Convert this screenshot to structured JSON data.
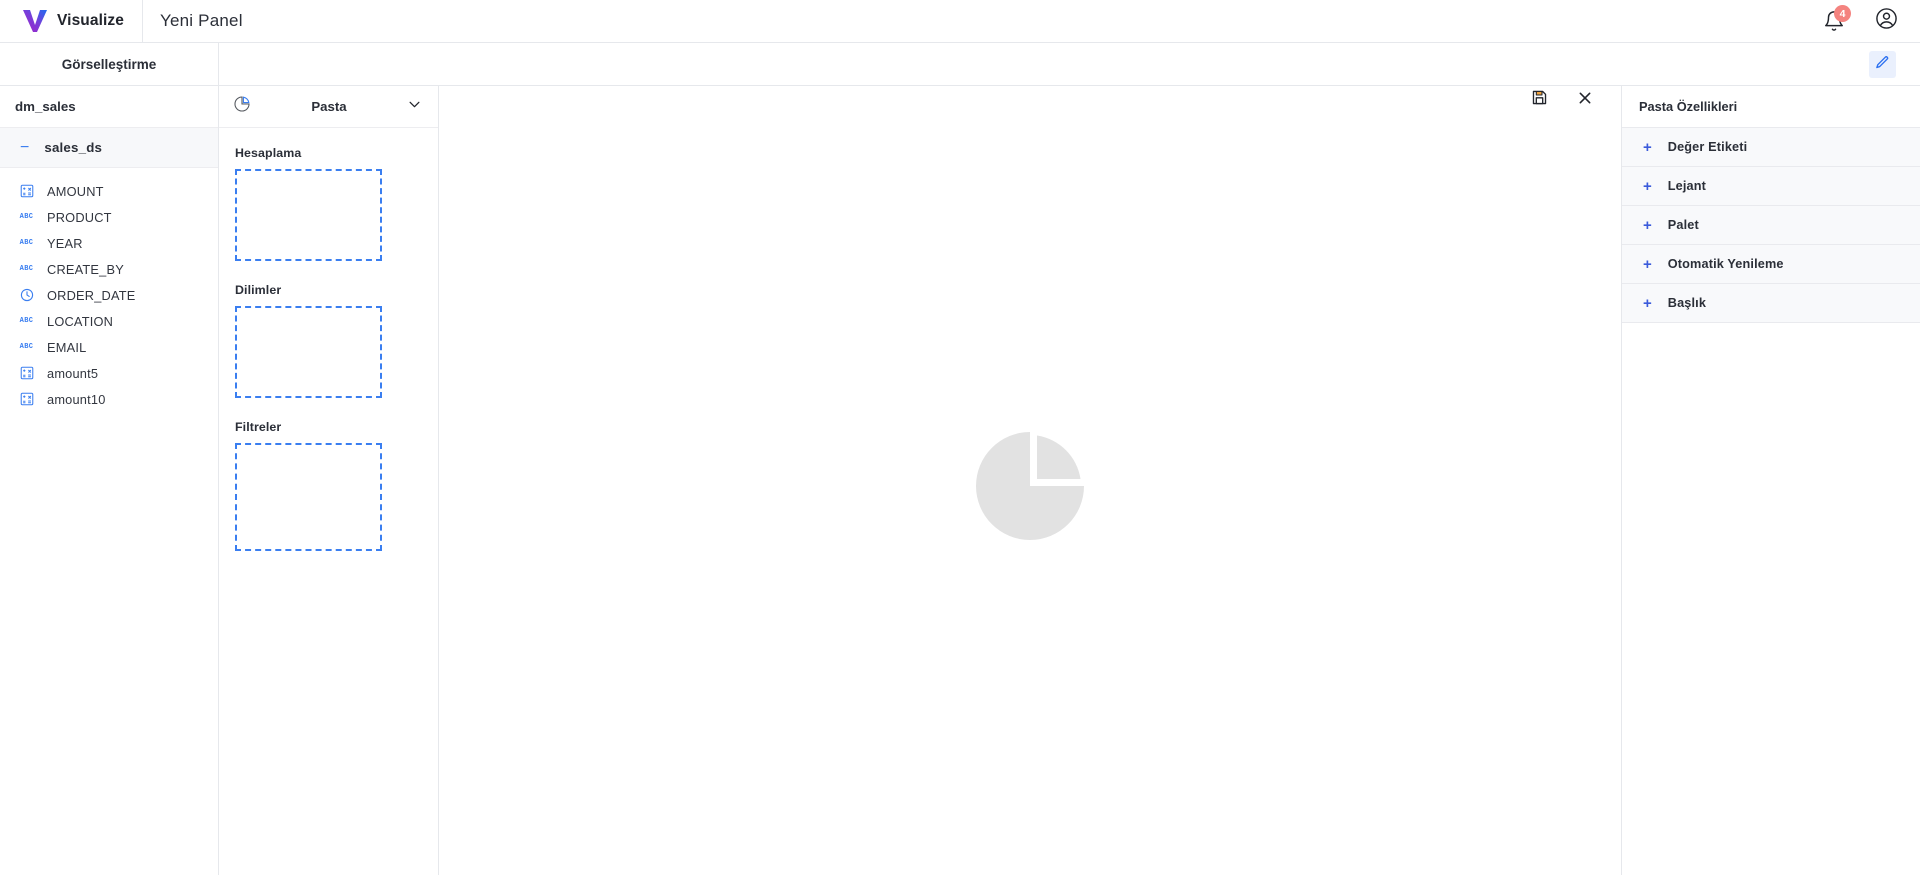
{
  "topbar": {
    "brand": "Visualize",
    "panel_title": "Yeni Panel",
    "notification_count": "4",
    "bell_icon": "bell-icon",
    "account_icon": "account-circle-icon",
    "logo_icon": "visualize-v-logo"
  },
  "tabbar": {
    "visualization_tab": "Görselleştirme",
    "edit_icon": "pencil-edit-icon"
  },
  "fields": {
    "datasource": "dm_sales",
    "dataset": "sales_ds",
    "collapse_icon": "minus-collapse-icon",
    "items": [
      {
        "label": "AMOUNT",
        "type": "number",
        "icon": "number-field-icon"
      },
      {
        "label": "PRODUCT",
        "type": "string",
        "icon": "abc-field-icon"
      },
      {
        "label": "YEAR",
        "type": "string",
        "icon": "abc-field-icon"
      },
      {
        "label": "CREATE_BY",
        "type": "string",
        "icon": "abc-field-icon"
      },
      {
        "label": "ORDER_DATE",
        "type": "date",
        "icon": "clock-field-icon"
      },
      {
        "label": "LOCATION",
        "type": "string",
        "icon": "abc-field-icon"
      },
      {
        "label": "EMAIL",
        "type": "string",
        "icon": "abc-field-icon"
      },
      {
        "label": "amount5",
        "type": "number",
        "icon": "number-field-icon"
      },
      {
        "label": "amount10",
        "type": "number",
        "icon": "number-field-icon"
      }
    ]
  },
  "shelf": {
    "chart_type": "Pasta",
    "chart_type_icon": "pie-chart-icon",
    "chevron_icon": "chevron-down-icon",
    "zones": [
      {
        "label": "Hesaplama",
        "size": "small"
      },
      {
        "label": "Dilimler",
        "size": "small"
      },
      {
        "label": "Filtreler",
        "size": "tall"
      }
    ]
  },
  "canvas": {
    "save_icon": "save-floppy-icon",
    "close_icon": "close-x-icon",
    "placeholder_icon": "pie-chart-placeholder"
  },
  "properties": {
    "title": "Pasta Özellikleri",
    "expand_icon": "plus-expand-icon",
    "items": [
      {
        "label": "Değer Etiketi"
      },
      {
        "label": "Lejant"
      },
      {
        "label": "Palet"
      },
      {
        "label": "Otomatik Yenileme"
      },
      {
        "label": "Başlık"
      }
    ]
  },
  "colors": {
    "accent_blue": "#3a7ef0",
    "badge_red": "#f4837f",
    "panel_bg": "#f8f9fb",
    "border": "#e6e8ec",
    "placeholder_gray": "#e2e2e2"
  }
}
